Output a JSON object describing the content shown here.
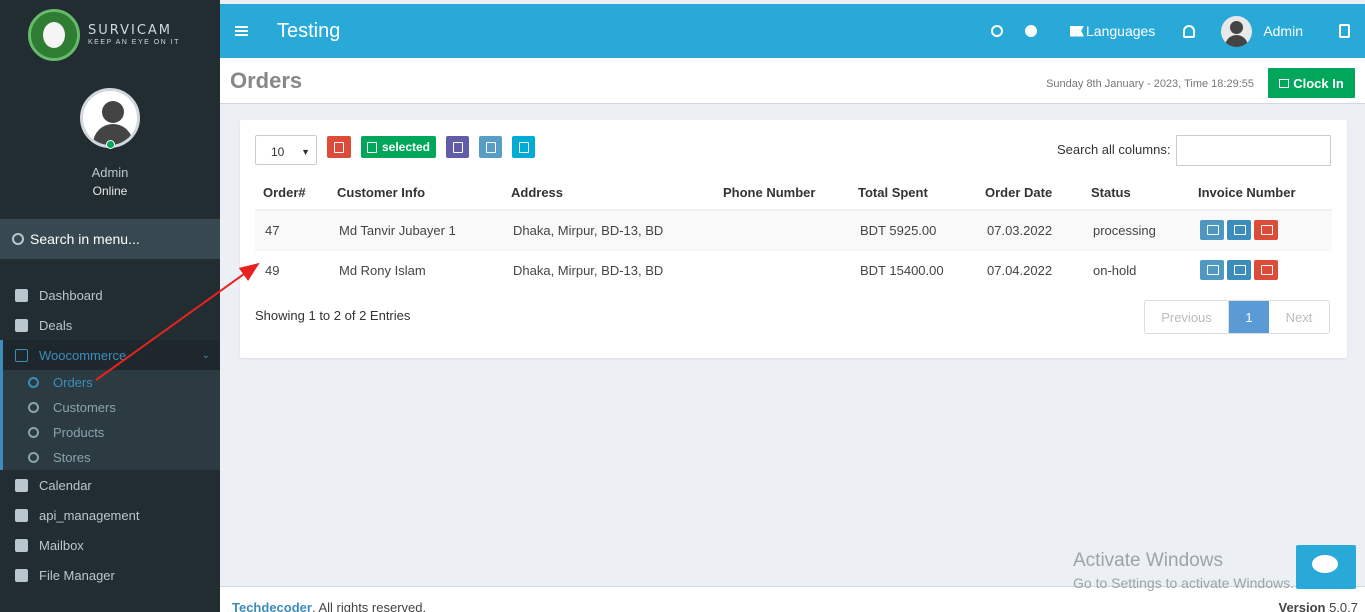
{
  "logo": {
    "brand": "SURVICAM",
    "tagline": "KEEP AN EYE ON IT"
  },
  "user": {
    "name": "Admin",
    "status": "Online"
  },
  "sidebar": {
    "search_label": "Search in menu...",
    "items": [
      {
        "label": "Dashboard"
      },
      {
        "label": "Deals"
      },
      {
        "label": "Woocommerce"
      },
      {
        "label": "Calendar"
      },
      {
        "label": "api_management"
      },
      {
        "label": "Mailbox"
      },
      {
        "label": "File Manager"
      }
    ],
    "submenu": [
      {
        "label": "Orders"
      },
      {
        "label": "Customers"
      },
      {
        "label": "Products"
      },
      {
        "label": "Stores"
      }
    ]
  },
  "header": {
    "title": "Testing",
    "languages": "Languages",
    "admin": "Admin"
  },
  "content_header": {
    "title": "Orders",
    "date": "Sunday 8th January - 2023,  Time  18:29:55",
    "clock_in": "Clock In"
  },
  "toolbar": {
    "page_length": "10",
    "selected_label": "selected",
    "search_label": "Search all columns:"
  },
  "table": {
    "headers": [
      "Order#",
      "Customer Info",
      "Address",
      "Phone Number",
      "Total Spent",
      "Order Date",
      "Status",
      "Invoice Number"
    ],
    "rows": [
      {
        "order": "47",
        "customer": "Md Tanvir Jubayer 1",
        "address": "Dhaka, Mirpur, BD-13, BD",
        "phone": "",
        "total": "BDT 5925.00",
        "date": "07.03.2022",
        "status": "processing"
      },
      {
        "order": "49",
        "customer": "Md Rony Islam",
        "address": "Dhaka, Mirpur, BD-13, BD",
        "phone": "",
        "total": "BDT 15400.00",
        "date": "07.04.2022",
        "status": "on-hold"
      }
    ]
  },
  "pagination": {
    "info": "Showing 1 to 2 of 2 Entries",
    "previous": "Previous",
    "current": "1",
    "next": "Next"
  },
  "footer": {
    "link": "Techdecoder",
    "rights": ". All rights reserved.",
    "version_label": "Version",
    "version": "5.0.7"
  },
  "overlay": {
    "activate_title": "Activate Windows",
    "activate_sub": "Go to Settings to activate Windows."
  },
  "colors": {
    "header": "#29a9d8",
    "sidebar": "#222d32",
    "accent": "#3c8dbc",
    "success": "#00a65a",
    "danger": "#dd4b39",
    "annotation_arrow": "#e8231f"
  }
}
